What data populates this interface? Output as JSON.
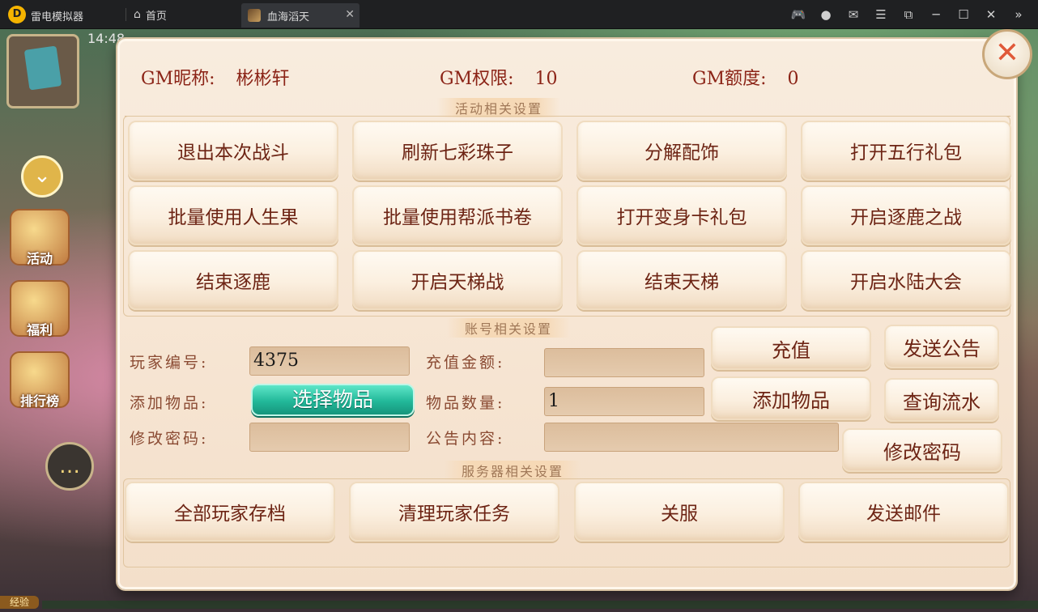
{
  "titlebar": {
    "app_name": "雷电模拟器",
    "logo_letter": "D",
    "home_tab": "首页",
    "game_tab": "血海滔天",
    "controls": [
      "gamepad-icon",
      "user-icon",
      "mail-icon",
      "menu-icon",
      "popout-icon",
      "minimize-icon",
      "maximize-icon",
      "close-icon",
      "collapse-icon"
    ]
  },
  "background": {
    "clock": "14:48",
    "side_icons": [
      "活动",
      "福利",
      "排行榜"
    ],
    "exp_label": "经验"
  },
  "gm_header": {
    "nickname_label": "GM昵称:",
    "nickname_value": "彬彬轩",
    "permission_label": "GM权限:",
    "permission_value": "10",
    "quota_label": "GM额度:",
    "quota_value": "0"
  },
  "activity": {
    "title": "活动相关设置",
    "buttons": [
      "退出本次战斗",
      "刷新七彩珠子",
      "分解配饰",
      "打开五行礼包",
      "批量使用人生果",
      "批量使用帮派书卷",
      "打开变身卡礼包",
      "开启逐鹿之战",
      "结束逐鹿",
      "开启天梯战",
      "结束天梯",
      "开启水陆大会"
    ]
  },
  "account": {
    "title": "账号相关设置",
    "player_id_label": "玩家编号:",
    "player_id_value": "4375",
    "recharge_amount_label": "充值金额:",
    "recharge_amount_value": "",
    "add_item_label": "添加物品:",
    "select_item_button": "选择物品",
    "item_quantity_label": "物品数量:",
    "item_quantity_value": "1",
    "change_password_label": "修改密码:",
    "password_value": "",
    "announcement_label": "公告内容:",
    "announcement_value": "",
    "buttons": {
      "recharge": "充值",
      "send_announcement": "发送公告",
      "add_item": "添加物品",
      "query_flow": "查询流水",
      "change_password": "修改密码"
    }
  },
  "server": {
    "title": "服务器相关设置",
    "buttons": [
      "全部玩家存档",
      "清理玩家任务",
      "关服",
      "发送邮件"
    ]
  },
  "colors": {
    "panel_bg": "#f7e6d4",
    "text_red": "#8b2316",
    "button_text": "#6d2414",
    "accent_teal": "#22b899",
    "close_red": "#e05a3a"
  }
}
